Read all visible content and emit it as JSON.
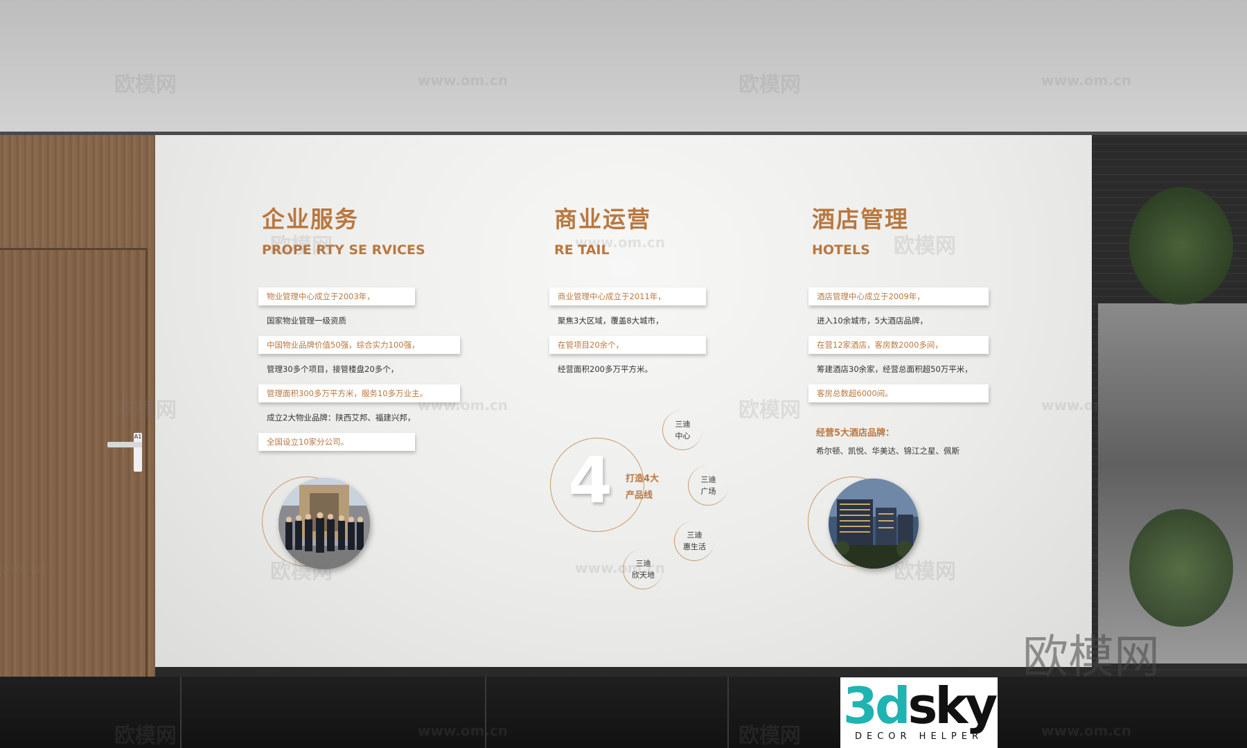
{
  "door": {
    "tag": "A1"
  },
  "columns": [
    {
      "title": "企业服务",
      "subtitle": "PROPE RTY SE RVICES",
      "items": [
        {
          "text": "物业管理中心成立于2003年，",
          "style": "card"
        },
        {
          "text": "国家物业管理一级资质",
          "style": "plain"
        },
        {
          "text": "中国物业品牌价值50强，综合实力100强，",
          "style": "card"
        },
        {
          "text": "管理30多个项目，接管楼盘20多个，",
          "style": "plain"
        },
        {
          "text": "管理面积300多万平方米，服务10多万业主。",
          "style": "card"
        },
        {
          "text": "成立2大物业品牌：陕西艾邦、福建兴邦，",
          "style": "plain"
        },
        {
          "text": "全国设立10家分公司。",
          "style": "card"
        }
      ]
    },
    {
      "title": "商业运营",
      "subtitle": "RE TAIL",
      "items": [
        {
          "text": "商业管理中心成立于2011年，",
          "style": "card"
        },
        {
          "text": "聚焦3大区域，覆盖8大城市，",
          "style": "plain"
        },
        {
          "text": "在管项目20余个，",
          "style": "card"
        },
        {
          "text": "经营面积200多万平方米。",
          "style": "plain"
        }
      ],
      "diagram": {
        "number": "4",
        "label": "打造4大\n产品线",
        "bubbles": [
          "三迪\n中心",
          "三迪\n广场",
          "三迪\n惠生活",
          "三迪\n欣天地"
        ]
      }
    },
    {
      "title": "酒店管理",
      "subtitle": "HOTELS",
      "items": [
        {
          "text": "酒店管理中心成立于2009年，",
          "style": "card"
        },
        {
          "text": "进入10余城市，5大酒店品牌，",
          "style": "plain"
        },
        {
          "text": "在营12家酒店，客房数2000多间，",
          "style": "card"
        },
        {
          "text": "筹建酒店30余家，经营总面积超50万平米，",
          "style": "plain"
        },
        {
          "text": "客房总数超6000间。",
          "style": "card"
        }
      ],
      "brands_heading": "经营5大酒店品牌：",
      "brands": "希尔顿、凯悦、华美达、锦江之星、佩斯"
    }
  ],
  "watermarks": {
    "brand": "欧模网",
    "url": "www.om.cn",
    "domain_fragment": "om.cn"
  },
  "logo": {
    "part1": "3d",
    "part2": "sky",
    "sub": "DECOR HELPER"
  },
  "colors": {
    "accent": "#b9773f",
    "wall": "#ececea",
    "wood": "#8a6a4e"
  }
}
